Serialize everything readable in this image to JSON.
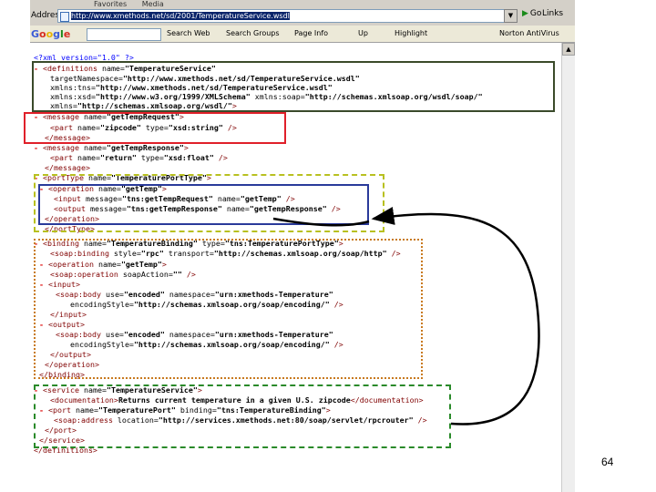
{
  "browser": {
    "address_label": "Address",
    "address_url": "http://www.xmethods.net/sd/2001/TemperatureService.wsdl",
    "go_label": "Go",
    "links_label": "Links",
    "menu_items": [
      "Favorites",
      "Media"
    ],
    "google_toolbar": {
      "logo": [
        "G",
        "o",
        "o",
        "g",
        "l",
        "e"
      ],
      "search_web": "Search Web",
      "search_groups": "Search Groups",
      "page_info": "Page Info",
      "up": "Up",
      "highlight": "Highlight",
      "norton": "Norton AntiVirus"
    }
  },
  "xml_lines": [
    {
      "mk": "",
      "parts": [
        {
          "c": "pi",
          "t": "<?xml version=\"1.0\" ?>"
        }
      ]
    },
    {
      "mk": "-",
      "parts": [
        {
          "c": "tag",
          "t": "<definitions"
        },
        {
          "c": "att",
          "t": " name="
        },
        {
          "c": "val",
          "t": "\"TemperatureService\""
        }
      ]
    },
    {
      "mk": "",
      "parts": [
        {
          "c": "att",
          "t": "targetNamespace="
        },
        {
          "c": "val",
          "t": "\"http://www.xmethods.net/sd/TemperatureService.wsdl\""
        }
      ]
    },
    {
      "mk": "",
      "parts": [
        {
          "c": "att",
          "t": "xmlns:tns="
        },
        {
          "c": "val",
          "t": "\"http://www.xmethods.net/sd/TemperatureService.wsdl\""
        }
      ]
    },
    {
      "mk": "",
      "parts": [
        {
          "c": "att",
          "t": "xmlns:xsd="
        },
        {
          "c": "val",
          "t": "\"http://www.w3.org/1999/XMLSchema\""
        },
        {
          "c": "att",
          "t": " xmlns:soap="
        },
        {
          "c": "val",
          "t": "\"http://schemas.xmlsoap.org/wsdl/soap/\""
        }
      ]
    },
    {
      "mk": "",
      "parts": [
        {
          "c": "att",
          "t": "xmlns="
        },
        {
          "c": "val",
          "t": "\"http://schemas.xmlsoap.org/wsdl/\""
        },
        {
          "c": "tag",
          "t": ">"
        }
      ]
    },
    {
      "mk": "-",
      "parts": [
        {
          "c": "tag",
          "t": "<message"
        },
        {
          "c": "att",
          "t": " name="
        },
        {
          "c": "val",
          "t": "\"getTempRequest\""
        },
        {
          "c": "tag",
          "t": ">"
        }
      ]
    },
    {
      "mk": "",
      "parts": [
        {
          "c": "tag",
          "t": "<part"
        },
        {
          "c": "att",
          "t": " name="
        },
        {
          "c": "val",
          "t": "\"zipcode\""
        },
        {
          "c": "att",
          "t": " type="
        },
        {
          "c": "val",
          "t": "\"xsd:string\""
        },
        {
          "c": "tag",
          "t": " />"
        }
      ]
    },
    {
      "mk": "",
      "parts": [
        {
          "c": "tag",
          "t": "</message>"
        }
      ]
    },
    {
      "mk": "-",
      "parts": [
        {
          "c": "tag",
          "t": "<message"
        },
        {
          "c": "att",
          "t": " name="
        },
        {
          "c": "val",
          "t": "\"getTempResponse\""
        },
        {
          "c": "tag",
          "t": ">"
        }
      ]
    },
    {
      "mk": "",
      "parts": [
        {
          "c": "tag",
          "t": "<part"
        },
        {
          "c": "att",
          "t": " name="
        },
        {
          "c": "val",
          "t": "\"return\""
        },
        {
          "c": "att",
          "t": " type="
        },
        {
          "c": "val",
          "t": "\"xsd:float\""
        },
        {
          "c": "tag",
          "t": " />"
        }
      ]
    },
    {
      "mk": "",
      "parts": [
        {
          "c": "tag",
          "t": "</message>"
        }
      ]
    },
    {
      "mk": "-",
      "parts": [
        {
          "c": "tag",
          "t": "<portType"
        },
        {
          "c": "att",
          "t": " name="
        },
        {
          "c": "val",
          "t": "\"TemperaturePortType\""
        },
        {
          "c": "tag",
          "t": ">"
        }
      ]
    },
    {
      "mk": "-",
      "parts": [
        {
          "c": "tag",
          "t": "<operation"
        },
        {
          "c": "att",
          "t": " name="
        },
        {
          "c": "val",
          "t": "\"getTemp\""
        },
        {
          "c": "tag",
          "t": ">"
        }
      ]
    },
    {
      "mk": "",
      "parts": [
        {
          "c": "tag",
          "t": "<input"
        },
        {
          "c": "att",
          "t": " message="
        },
        {
          "c": "val",
          "t": "\"tns:getTempRequest\""
        },
        {
          "c": "att",
          "t": " name="
        },
        {
          "c": "val",
          "t": "\"getTemp\""
        },
        {
          "c": "tag",
          "t": " />"
        }
      ]
    },
    {
      "mk": "",
      "parts": [
        {
          "c": "tag",
          "t": "<output"
        },
        {
          "c": "att",
          "t": " message="
        },
        {
          "c": "val",
          "t": "\"tns:getTempResponse\""
        },
        {
          "c": "att",
          "t": " name="
        },
        {
          "c": "val",
          "t": "\"getTempResponse\""
        },
        {
          "c": "tag",
          "t": " />"
        }
      ]
    },
    {
      "mk": "",
      "parts": [
        {
          "c": "tag",
          "t": "</operation>"
        }
      ]
    },
    {
      "mk": "",
      "parts": [
        {
          "c": "tag",
          "t": "</portType>"
        }
      ]
    },
    {
      "mk": "-",
      "parts": [
        {
          "c": "tag",
          "t": "<binding"
        },
        {
          "c": "att",
          "t": " name="
        },
        {
          "c": "val",
          "t": "\"TemperatureBinding\""
        },
        {
          "c": "att",
          "t": " type="
        },
        {
          "c": "val",
          "t": "\"tns:TemperaturePortType\""
        },
        {
          "c": "tag",
          "t": ">"
        }
      ]
    },
    {
      "mk": "",
      "parts": [
        {
          "c": "tag",
          "t": "<soap:binding"
        },
        {
          "c": "att",
          "t": " style="
        },
        {
          "c": "val",
          "t": "\"rpc\""
        },
        {
          "c": "att",
          "t": " transport="
        },
        {
          "c": "val",
          "t": "\"http://schemas.xmlsoap.org/soap/http\""
        },
        {
          "c": "tag",
          "t": " />"
        }
      ]
    },
    {
      "mk": "-",
      "parts": [
        {
          "c": "tag",
          "t": "<operation"
        },
        {
          "c": "att",
          "t": " name="
        },
        {
          "c": "val",
          "t": "\"getTemp\""
        },
        {
          "c": "tag",
          "t": ">"
        }
      ]
    },
    {
      "mk": "",
      "parts": [
        {
          "c": "tag",
          "t": "<soap:operation"
        },
        {
          "c": "att",
          "t": " soapAction="
        },
        {
          "c": "val",
          "t": "\"\""
        },
        {
          "c": "tag",
          "t": " />"
        }
      ]
    },
    {
      "mk": "-",
      "parts": [
        {
          "c": "tag",
          "t": "<input>"
        }
      ]
    },
    {
      "mk": "",
      "parts": [
        {
          "c": "tag",
          "t": "<soap:body"
        },
        {
          "c": "att",
          "t": " use="
        },
        {
          "c": "val",
          "t": "\"encoded\""
        },
        {
          "c": "att",
          "t": " namespace="
        },
        {
          "c": "val",
          "t": "\"urn:xmethods-Temperature\""
        }
      ]
    },
    {
      "mk": "",
      "parts": [
        {
          "c": "att",
          "t": "encodingStyle="
        },
        {
          "c": "val",
          "t": "\"http://schemas.xmlsoap.org/soap/encoding/\""
        },
        {
          "c": "tag",
          "t": " />"
        }
      ]
    },
    {
      "mk": "",
      "parts": [
        {
          "c": "tag",
          "t": "</input>"
        }
      ]
    },
    {
      "mk": "-",
      "parts": [
        {
          "c": "tag",
          "t": "<output>"
        }
      ]
    },
    {
      "mk": "",
      "parts": [
        {
          "c": "tag",
          "t": "<soap:body"
        },
        {
          "c": "att",
          "t": " use="
        },
        {
          "c": "val",
          "t": "\"encoded\""
        },
        {
          "c": "att",
          "t": " namespace="
        },
        {
          "c": "val",
          "t": "\"urn:xmethods-Temperature\""
        }
      ]
    },
    {
      "mk": "",
      "parts": [
        {
          "c": "att",
          "t": "encodingStyle="
        },
        {
          "c": "val",
          "t": "\"http://schemas.xmlsoap.org/soap/encoding/\""
        },
        {
          "c": "tag",
          "t": " />"
        }
      ]
    },
    {
      "mk": "",
      "parts": [
        {
          "c": "tag",
          "t": "</output>"
        }
      ]
    },
    {
      "mk": "",
      "parts": [
        {
          "c": "tag",
          "t": "</operation>"
        }
      ]
    },
    {
      "mk": "",
      "parts": [
        {
          "c": "tag",
          "t": "</binding>"
        }
      ]
    },
    {
      "mk": "-",
      "parts": [
        {
          "c": "tag",
          "t": "<service"
        },
        {
          "c": "att",
          "t": " name="
        },
        {
          "c": "val",
          "t": "\"TemperatureService\""
        },
        {
          "c": "tag",
          "t": ">"
        }
      ]
    },
    {
      "mk": "",
      "parts": [
        {
          "c": "tag",
          "t": "<documentation>"
        },
        {
          "c": "txt",
          "t": "Returns current temperature in a given U.S. zipcode"
        },
        {
          "c": "tag",
          "t": "</documentation>"
        }
      ]
    },
    {
      "mk": "-",
      "parts": [
        {
          "c": "tag",
          "t": "<port"
        },
        {
          "c": "att",
          "t": " name="
        },
        {
          "c": "val",
          "t": "\"TemperaturePort\""
        },
        {
          "c": "att",
          "t": " binding="
        },
        {
          "c": "val",
          "t": "\"tns:TemperatureBinding\""
        },
        {
          "c": "tag",
          "t": ">"
        }
      ]
    },
    {
      "mk": "",
      "parts": [
        {
          "c": "tag",
          "t": "<soap:address"
        },
        {
          "c": "att",
          "t": " location="
        },
        {
          "c": "val",
          "t": "\"http://services.xmethods.net:80/soap/servlet/rpcrouter\""
        },
        {
          "c": "tag",
          "t": " />"
        }
      ]
    },
    {
      "mk": "",
      "parts": [
        {
          "c": "tag",
          "t": "</port>"
        }
      ]
    },
    {
      "mk": "",
      "parts": [
        {
          "c": "tag",
          "t": "</service>"
        }
      ]
    },
    {
      "mk": "",
      "parts": [
        {
          "c": "tag",
          "t": "</definitions>"
        }
      ]
    }
  ],
  "annotation_colors": {
    "definitions_box": "#3a4a2a",
    "message_box": "#e0202a",
    "porttype_box": "#b8c020",
    "operation_box": "#2a3a9a",
    "binding_box": "#c87a20",
    "service_box": "#2a8a2a",
    "arrow": "#000000"
  },
  "slide_number": "64"
}
